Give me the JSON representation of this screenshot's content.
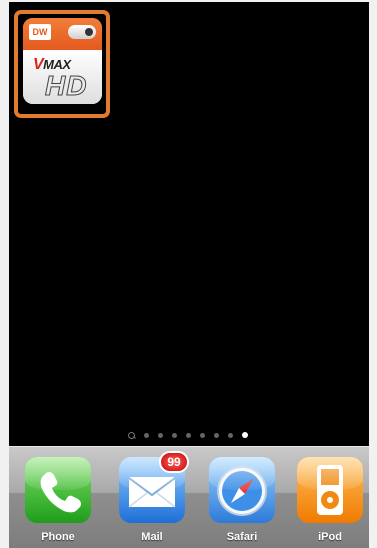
{
  "home_screen": {
    "highlighted_app": {
      "brand_badge": "DW",
      "logo_prefix": "V",
      "logo_word": "MAX",
      "logo_suffix": "HD"
    },
    "page_indicator": {
      "pages": 8,
      "active_index": 7
    }
  },
  "dock": {
    "apps": [
      {
        "name": "phone",
        "label": "Phone"
      },
      {
        "name": "mail",
        "label": "Mail",
        "badge": "99"
      },
      {
        "name": "safari",
        "label": "Safari"
      },
      {
        "name": "ipod",
        "label": "iPod"
      }
    ]
  },
  "colors": {
    "highlight_border": "#e07b2f",
    "screen_background": "#000000",
    "badge_red": "#d40000"
  }
}
